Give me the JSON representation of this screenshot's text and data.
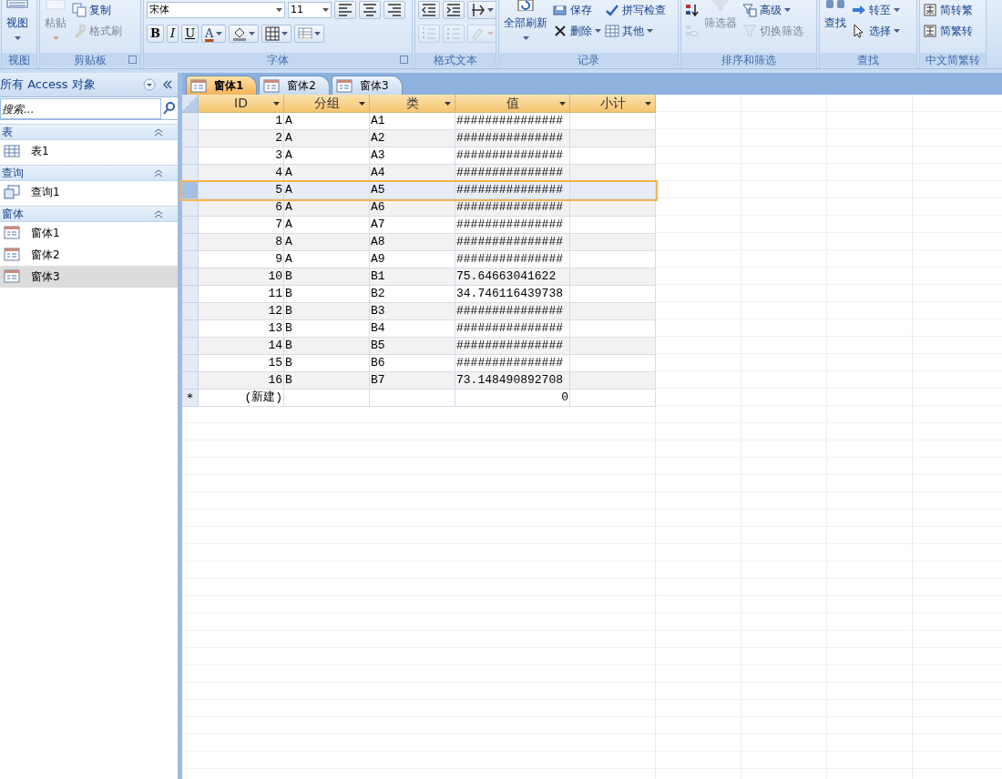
{
  "ribbon": {
    "groups": [
      {
        "label": "视图",
        "launcher": false,
        "commands": [
          {
            "kind": "large",
            "label": "视图",
            "disabled": false,
            "dropdown": true
          }
        ]
      },
      {
        "label": "剪贴板",
        "launcher": true,
        "commands": [
          {
            "kind": "large",
            "label": "粘贴",
            "disabled": true,
            "dropdown": true
          },
          {
            "kind": "small",
            "label": "复制",
            "disabled": false,
            "dropdown": false
          },
          {
            "kind": "small",
            "label": "格式刷",
            "disabled": true,
            "dropdown": false
          }
        ]
      },
      {
        "label": "字体",
        "launcher": true,
        "rows": [
          [
            {
              "kind": "field",
              "value": "宋体"
            },
            {
              "kind": "field",
              "value": "11"
            },
            {
              "kind": "icon",
              "disabled": false,
              "dropdown": false
            },
            {
              "kind": "icon",
              "disabled": false,
              "dropdown": false
            },
            {
              "kind": "icon",
              "disabled": false,
              "dropdown": false
            }
          ],
          [
            {
              "kind": "text",
              "label": "B",
              "disabled": false,
              "dropdown": false
            },
            {
              "kind": "text",
              "label": "I",
              "disabled": false,
              "dropdown": false
            },
            {
              "kind": "text",
              "label": "U",
              "disabled": false,
              "dropdown": false
            },
            {
              "kind": "text",
              "label": "A",
              "disabled": false,
              "dropdown": true
            },
            {
              "kind": "icon",
              "disabled": false,
              "dropdown": true
            },
            {
              "kind": "icon",
              "disabled": false,
              "dropdown": true
            },
            {
              "kind": "icon",
              "disabled": false,
              "dropdown": true
            }
          ]
        ]
      },
      {
        "label": "格式文本",
        "launcher": false,
        "rows": [
          [
            {
              "kind": "icon",
              "disabled": false,
              "dropdown": false
            },
            {
              "kind": "icon",
              "disabled": false,
              "dropdown": false
            },
            {
              "kind": "icon",
              "disabled": false,
              "dropdown": true
            }
          ],
          [
            {
              "kind": "icon",
              "disabled": true,
              "dropdown": false
            },
            {
              "kind": "icon",
              "disabled": true,
              "dropdown": false
            },
            {
              "kind": "icon",
              "disabled": true,
              "dropdown": true
            }
          ]
        ]
      },
      {
        "label": "记录",
        "launcher": false,
        "commands": [
          {
            "kind": "large",
            "label": "全部刷新",
            "disabled": false,
            "dropdown": true
          },
          {
            "kind": "small",
            "label": "保存",
            "disabled": false,
            "dropdown": false
          },
          {
            "kind": "small",
            "label": "删除",
            "disabled": false,
            "dropdown": true
          },
          {
            "kind": "small",
            "label": "拼写检查",
            "disabled": false,
            "dropdown": false
          },
          {
            "kind": "small",
            "label": "其他",
            "disabled": false,
            "dropdown": true
          }
        ]
      },
      {
        "label": "排序和筛选",
        "launcher": false,
        "commands": [
          {
            "kind": "small",
            "disabled": false,
            "dropdown": false
          },
          {
            "kind": "small",
            "disabled": true,
            "dropdown": false
          },
          {
            "kind": "large",
            "label": "筛选器",
            "disabled": true,
            "dropdown": false
          },
          {
            "kind": "small",
            "label": "高级",
            "disabled": false,
            "dropdown": true
          },
          {
            "kind": "small",
            "label": "切换筛选",
            "disabled": true,
            "dropdown": false
          }
        ]
      },
      {
        "label": "查找",
        "launcher": false,
        "commands": [
          {
            "kind": "large",
            "label": "查找",
            "disabled": false,
            "dropdown": false
          },
          {
            "kind": "small",
            "label": "转至",
            "disabled": false,
            "dropdown": true
          },
          {
            "kind": "small",
            "label": "选择",
            "disabled": false,
            "dropdown": true
          }
        ]
      },
      {
        "label": "中文简繁转",
        "launcher": false,
        "commands": [
          {
            "kind": "small",
            "label": "简转繁",
            "disabled": false,
            "dropdown": false
          },
          {
            "kind": "small",
            "label": "简繁转",
            "disabled": false,
            "dropdown": false
          }
        ]
      }
    ]
  },
  "navigation": {
    "title": "所有 Access 对象",
    "search": {
      "placeholder": "搜索..."
    },
    "sections": [
      {
        "label": "表",
        "expanded": true,
        "items": [
          {
            "label": "表1",
            "kind": "table",
            "selected": false
          }
        ]
      },
      {
        "label": "查询",
        "expanded": true,
        "items": [
          {
            "label": "查询1",
            "kind": "query",
            "selected": false
          }
        ]
      },
      {
        "label": "窗体",
        "expanded": true,
        "items": [
          {
            "label": "窗体1",
            "kind": "form",
            "selected": false
          },
          {
            "label": "窗体2",
            "kind": "form",
            "selected": false
          },
          {
            "label": "窗体3",
            "kind": "form",
            "selected": true
          }
        ]
      }
    ]
  },
  "tabs": [
    {
      "label": "窗体1",
      "selected": true
    },
    {
      "label": "窗体2",
      "selected": false
    },
    {
      "label": "窗体3",
      "selected": false
    }
  ],
  "table": {
    "columns": [
      "ID",
      "分组",
      "类",
      "值",
      "小计"
    ],
    "rows": [
      {
        "cells": [
          "1",
          "A",
          "A1",
          "###############",
          ""
        ],
        "selected": false
      },
      {
        "cells": [
          "2",
          "A",
          "A2",
          "###############",
          ""
        ],
        "selected": false
      },
      {
        "cells": [
          "3",
          "A",
          "A3",
          "###############",
          ""
        ],
        "selected": false
      },
      {
        "cells": [
          "4",
          "A",
          "A4",
          "###############",
          ""
        ],
        "selected": false
      },
      {
        "cells": [
          "5",
          "A",
          "A5",
          "###############",
          ""
        ],
        "selected": true
      },
      {
        "cells": [
          "6",
          "A",
          "A6",
          "###############",
          ""
        ],
        "selected": false
      },
      {
        "cells": [
          "7",
          "A",
          "A7",
          "###############",
          ""
        ],
        "selected": false
      },
      {
        "cells": [
          "8",
          "A",
          "A8",
          "###############",
          ""
        ],
        "selected": false
      },
      {
        "cells": [
          "9",
          "A",
          "A9",
          "###############",
          ""
        ],
        "selected": false
      },
      {
        "cells": [
          "10",
          "B",
          "B1",
          "75.64663041622",
          ""
        ],
        "selected": false
      },
      {
        "cells": [
          "11",
          "B",
          "B2",
          "34.746116439738",
          ""
        ],
        "selected": false
      },
      {
        "cells": [
          "12",
          "B",
          "B3",
          "###############",
          ""
        ],
        "selected": false
      },
      {
        "cells": [
          "13",
          "B",
          "B4",
          "###############",
          ""
        ],
        "selected": false
      },
      {
        "cells": [
          "14",
          "B",
          "B5",
          "###############",
          ""
        ],
        "selected": false
      },
      {
        "cells": [
          "15",
          "B",
          "B6",
          "###############",
          ""
        ],
        "selected": false
      },
      {
        "cells": [
          "16",
          "B",
          "B7",
          "73.148490892708",
          ""
        ],
        "selected": false
      }
    ],
    "new_row": {
      "marker": "*",
      "cells": [
        "(新建)",
        "",
        "",
        "0",
        ""
      ]
    }
  }
}
